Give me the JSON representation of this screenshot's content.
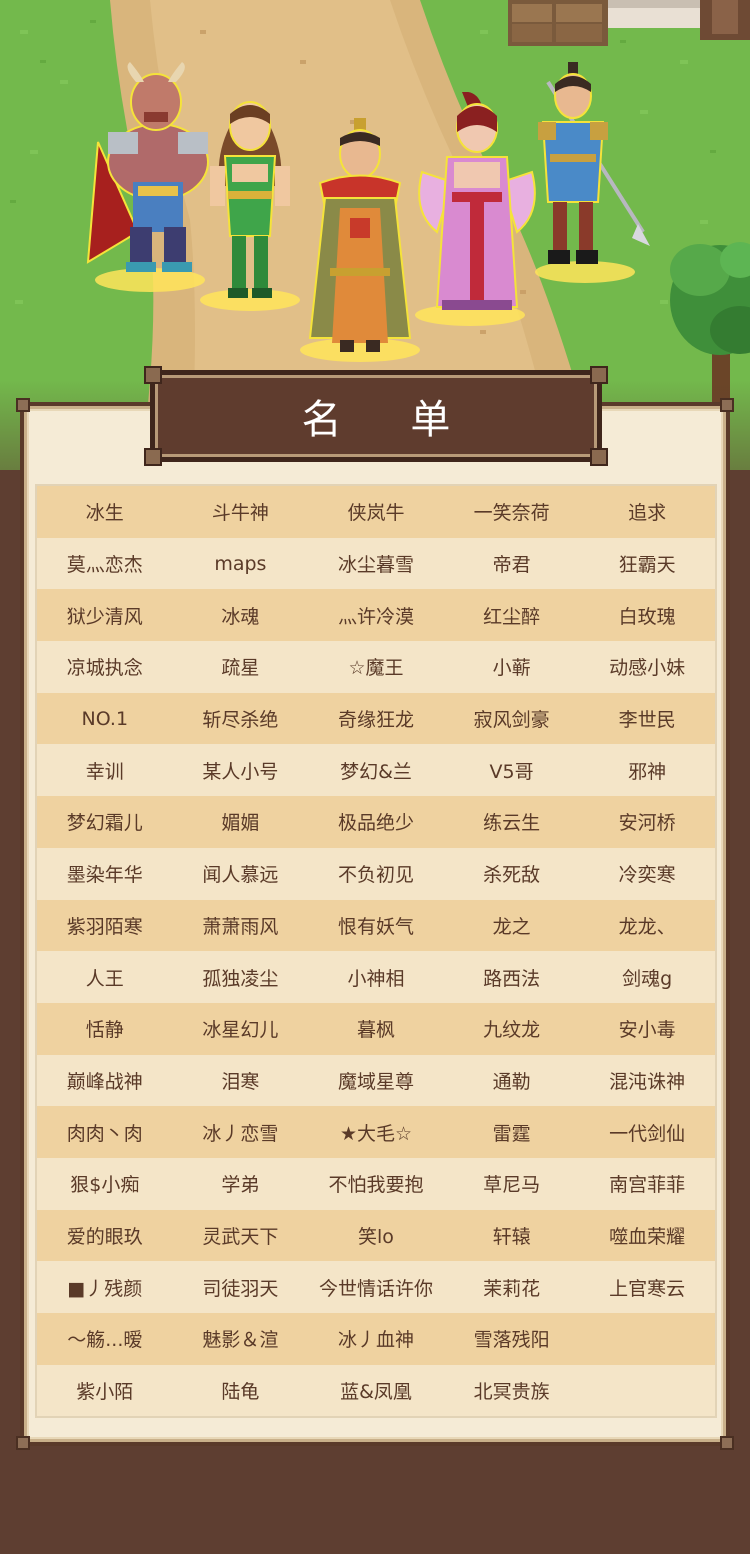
{
  "title": "名 单",
  "rows": [
    [
      "冰生",
      "斗牛神",
      "侠岚牛",
      "一笑奈荷",
      "追求"
    ],
    [
      "莫灬恋杰",
      "maps",
      "冰尘暮雪",
      "帝君",
      "狂霸天"
    ],
    [
      "狱少清风",
      "冰魂",
      "灬许冷漠",
      "红尘醉",
      "白玫瑰"
    ],
    [
      "凉城执念",
      "疏星",
      "☆魔王",
      "小蕲",
      "动感小妹"
    ],
    [
      "NO.1",
      "斩尽杀绝",
      "奇缘狂龙",
      "寂风剑豪",
      "李世民"
    ],
    [
      "幸训",
      "某人小号",
      "梦幻&兰",
      "V5哥",
      "邪神"
    ],
    [
      "梦幻霜儿",
      "媚媚",
      "极品绝少",
      "练云生",
      "安河桥"
    ],
    [
      "墨染年华",
      "闻人慕远",
      "不负初见",
      "杀死敌",
      "冷奕寒"
    ],
    [
      "紫羽陌寒",
      "萧萧雨风",
      "恨有妖气",
      "龙之",
      "龙龙、"
    ],
    [
      "人王",
      "孤独凌尘",
      "小神相",
      "路西法",
      "剑魂g"
    ],
    [
      "恬静",
      "冰星幻儿",
      "暮枫",
      "九纹龙",
      "安小毒"
    ],
    [
      "巅峰战神",
      "泪寒",
      "魔域星尊",
      "通勒",
      "混沌诛神"
    ],
    [
      "肉肉丶肉",
      "冰丿恋雪",
      "★大毛☆",
      "雷霆",
      "一代剑仙"
    ],
    [
      "狠$小痴",
      "学弟",
      "不怕我要抱",
      "草尼马",
      "南宫菲菲"
    ],
    [
      "爱的眼玖",
      "灵武天下",
      "笑lo",
      "轩辕",
      "噬血荣耀"
    ],
    [
      "■丿残颜",
      "司徒羽天",
      "今世情话许你",
      "茉莉花",
      "上官寒云"
    ],
    [
      "～觞...暧",
      "魅影＆渲",
      "冰丿血神",
      "雪落残阳",
      ""
    ],
    [
      "紫小陌",
      "陆龟",
      "蓝&凤凰",
      "北冥贵族",
      ""
    ]
  ],
  "characters": [
    "bull-demon",
    "green-dancer",
    "emperor",
    "pink-fairy",
    "spear-warrior"
  ]
}
